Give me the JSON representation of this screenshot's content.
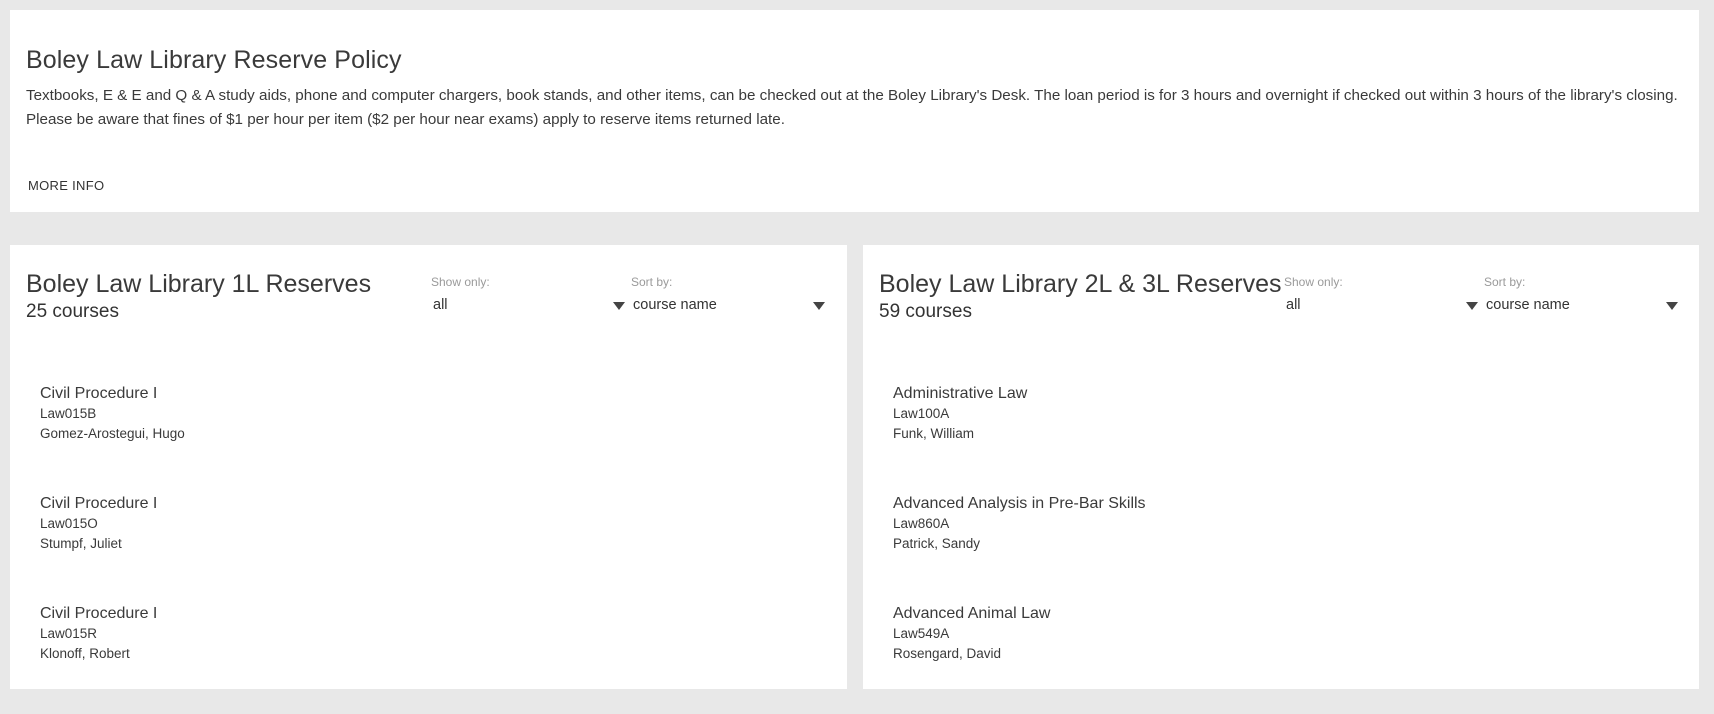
{
  "policy": {
    "title": "Boley Law Library Reserve Policy",
    "text": "Textbooks, E & E and Q & A study aids, phone and computer chargers, book stands, and other items, can be checked out at the Boley Library's Desk. The loan period is for 3 hours and overnight if checked out within 3 hours of the library's closing. Please be aware that fines of $1 per hour per item ($2 per hour near exams) apply to reserve items returned late.",
    "more_info_label": "MORE INFO"
  },
  "reserves_1l": {
    "title": "Boley Law Library 1L Reserves",
    "count": "25 courses",
    "show_only": {
      "label": "Show only:",
      "value": "all"
    },
    "sort_by": {
      "label": "Sort by:",
      "value": "course name"
    },
    "courses": [
      {
        "name": "Civil Procedure I",
        "code": "Law015B",
        "instructor": "Gomez-Arostegui, Hugo"
      },
      {
        "name": "Civil Procedure I",
        "code": "Law015O",
        "instructor": "Stumpf, Juliet"
      },
      {
        "name": "Civil Procedure I",
        "code": "Law015R",
        "instructor": "Klonoff, Robert"
      }
    ]
  },
  "reserves_2l3l": {
    "title": "Boley Law Library 2L & 3L Reserves",
    "count": "59 courses",
    "show_only": {
      "label": "Show only:",
      "value": "all"
    },
    "sort_by": {
      "label": "Sort by:",
      "value": "course name"
    },
    "courses": [
      {
        "name": "Administrative Law",
        "code": "Law100A",
        "instructor": "Funk, William"
      },
      {
        "name": "Advanced Analysis in Pre-Bar Skills",
        "code": "Law860A",
        "instructor": "Patrick, Sandy"
      },
      {
        "name": "Advanced Animal Law",
        "code": "Law549A",
        "instructor": "Rosengard, David"
      }
    ]
  }
}
